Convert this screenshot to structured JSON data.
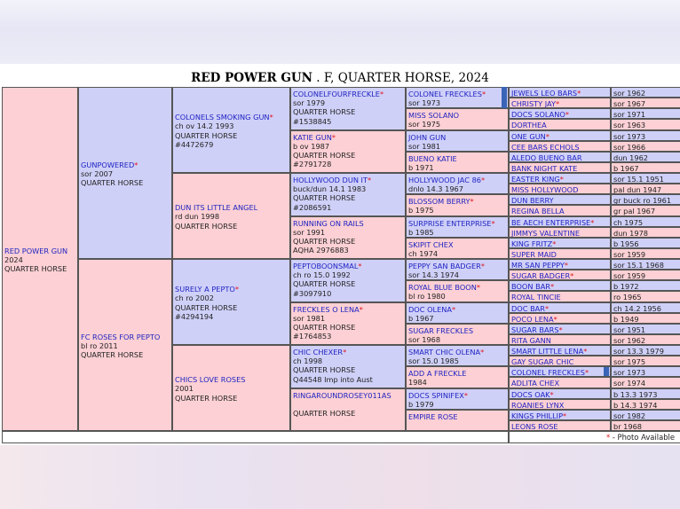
{
  "header": {
    "title_bold": "RED POWER GUN",
    "title_rest": " . F, QUARTER HORSE, 2024"
  },
  "subject": {
    "name": "RED POWER GUN",
    "lines": [
      "2024",
      "QUARTER HORSE"
    ]
  },
  "gen1": [
    {
      "name": "GUNPOWERED",
      "star": true,
      "lines": [
        "sor 2007",
        "QUARTER HORSE"
      ]
    },
    {
      "name": "FC ROSES FOR PEPTO",
      "star": false,
      "lines": [
        "bl ro 2011",
        "QUARTER HORSE"
      ]
    }
  ],
  "gen2": [
    {
      "name": "COLONELS SMOKING GUN",
      "star": true,
      "lines": [
        "ch ov 14.2 1993",
        "QUARTER HORSE",
        "#4472679"
      ]
    },
    {
      "name": "DUN ITS LITTLE ANGEL",
      "star": false,
      "lines": [
        "rd dun 1998",
        "QUARTER HORSE"
      ]
    },
    {
      "name": "SURELY A PEPTO",
      "star": true,
      "lines": [
        "ch ro 2002",
        "QUARTER HORSE",
        "#4294194"
      ]
    },
    {
      "name": "CHICS LOVE ROSES",
      "star": false,
      "lines": [
        "2001",
        "QUARTER HORSE"
      ]
    }
  ],
  "gen3": [
    {
      "name": "COLONELFOURFRECKLE",
      "star": true,
      "lines": [
        "sor 1979",
        "QUARTER HORSE",
        "#1538845"
      ]
    },
    {
      "name": "KATIE GUN",
      "star": true,
      "lines": [
        "b ov 1987",
        "QUARTER HORSE",
        "#2791728"
      ]
    },
    {
      "name": "HOLLYWOOD DUN IT",
      "star": true,
      "lines": [
        "buck/dun 14.1 1983",
        "QUARTER HORSE",
        "#2086591"
      ]
    },
    {
      "name": "RUNNING ON RAILS",
      "star": false,
      "lines": [
        "sor 1991",
        "QUARTER HORSE",
        "AQHA 2976883"
      ]
    },
    {
      "name": "PEPTOBOONSMAL",
      "star": true,
      "lines": [
        "ch ro 15.0 1992",
        "QUARTER HORSE",
        "#3097910"
      ]
    },
    {
      "name": "FRECKLES O LENA",
      "star": true,
      "lines": [
        "sor 1981",
        "QUARTER HORSE",
        "#1764853"
      ]
    },
    {
      "name": "CHIC CHEXER",
      "star": true,
      "lines": [
        "ch 1998",
        "QUARTER HORSE",
        "Q44548 Imp into Aust"
      ]
    },
    {
      "name": "RINGAROUNDROSEY011AS",
      "star": false,
      "lines": [
        "",
        "QUARTER HORSE"
      ]
    }
  ],
  "gen4": [
    {
      "name": "COLONEL FRECKLES",
      "star": true,
      "lines": [
        "sor 1973"
      ]
    },
    {
      "name": "MISS SOLANO",
      "star": false,
      "lines": [
        "sor 1975"
      ]
    },
    {
      "name": "JOHN GUN",
      "star": false,
      "lines": [
        "sor 1981"
      ]
    },
    {
      "name": "BUENO KATIE",
      "star": false,
      "lines": [
        "b 1971"
      ]
    },
    {
      "name": "HOLLYWOOD JAC 86",
      "star": true,
      "lines": [
        "dnlo 14.3 1967"
      ]
    },
    {
      "name": "BLOSSOM BERRY",
      "star": true,
      "lines": [
        "b 1975"
      ]
    },
    {
      "name": "SURPRISE ENTERPRISE",
      "star": true,
      "lines": [
        "b 1985"
      ]
    },
    {
      "name": "SKIPIT CHEX",
      "star": false,
      "lines": [
        "ch 1974"
      ]
    },
    {
      "name": "PEPPY SAN BADGER",
      "star": true,
      "lines": [
        "sor 14.3 1974"
      ]
    },
    {
      "name": "ROYAL BLUE BOON",
      "star": true,
      "lines": [
        "bl ro 1980"
      ]
    },
    {
      "name": "DOC OLENA",
      "star": true,
      "lines": [
        "b 1967"
      ]
    },
    {
      "name": "SUGAR FRECKLES",
      "star": false,
      "lines": [
        "sor 1968"
      ]
    },
    {
      "name": "SMART CHIC OLENA",
      "star": true,
      "lines": [
        "sor 15.0 1985"
      ]
    },
    {
      "name": "ADD A FRECKLE",
      "star": false,
      "lines": [
        "1984"
      ]
    },
    {
      "name": "DOCS SPINIFEX",
      "star": true,
      "lines": [
        "b 1979"
      ]
    },
    {
      "name": "EMPIRE ROSE",
      "star": false,
      "lines": [
        ""
      ]
    }
  ],
  "gen5": [
    {
      "name": "JEWELS LEO BARS",
      "star": true,
      "info": "sor 1962"
    },
    {
      "name": "CHRISTY JAY",
      "star": true,
      "info": "sor 1967"
    },
    {
      "name": "DOCS SOLANO",
      "star": true,
      "info": "sor 1971"
    },
    {
      "name": "DORTHEA",
      "star": false,
      "info": "sor 1963"
    },
    {
      "name": "ONE GUN",
      "star": true,
      "info": "sor 1973"
    },
    {
      "name": "CEE BARS ECHOLS",
      "star": false,
      "info": "sor 1966"
    },
    {
      "name": "ALEDO BUENO BAR",
      "star": false,
      "info": "dun 1962"
    },
    {
      "name": "BANK NIGHT KATE",
      "star": false,
      "info": "b 1967"
    },
    {
      "name": "EASTER KING",
      "star": true,
      "info": "sor 15.1 1951"
    },
    {
      "name": "MISS HOLLYWOOD",
      "star": false,
      "info": "pal dun 1947"
    },
    {
      "name": "DUN BERRY",
      "star": false,
      "info": "gr buck ro 1961"
    },
    {
      "name": "REGINA BELLA",
      "star": false,
      "info": "gr pal 1967"
    },
    {
      "name": "BE AECH ENTERPRISE",
      "star": true,
      "info": "ch 1975"
    },
    {
      "name": "JIMMYS VALENTINE",
      "star": false,
      "info": "dun 1978"
    },
    {
      "name": "KING FRITZ",
      "star": true,
      "info": "b 1956"
    },
    {
      "name": "SUPER MAID",
      "star": false,
      "info": "sor 1959"
    },
    {
      "name": "MR SAN PEPPY",
      "star": true,
      "info": "sor 15.1 1968"
    },
    {
      "name": "SUGAR BADGER",
      "star": true,
      "info": "sor 1959"
    },
    {
      "name": "BOON BAR",
      "star": true,
      "info": "b 1972"
    },
    {
      "name": "ROYAL TINCIE",
      "star": false,
      "info": "ro 1965"
    },
    {
      "name": "DOC BAR",
      "star": true,
      "info": "ch 14.2 1956"
    },
    {
      "name": "POCO LENA",
      "star": true,
      "info": "b 1949"
    },
    {
      "name": "SUGAR BARS",
      "star": true,
      "info": "sor 1951"
    },
    {
      "name": "RITA GANN",
      "star": false,
      "info": "sor 1962"
    },
    {
      "name": "SMART LITTLE LENA",
      "star": true,
      "info": "sor 13.3 1979"
    },
    {
      "name": "GAY SUGAR CHIC",
      "star": false,
      "info": "sor 1975"
    },
    {
      "name": "COLONEL FRECKLES",
      "star": true,
      "info": "sor 1973"
    },
    {
      "name": "ADLITA CHEX",
      "star": false,
      "info": "sor 1974"
    },
    {
      "name": "DOCS OAK",
      "star": true,
      "info": "b 13.3 1973"
    },
    {
      "name": "ROANIES LYNX",
      "star": false,
      "info": "b 14.3 1974"
    },
    {
      "name": "KINGS PHILLIP",
      "star": true,
      "info": "sor 1982"
    },
    {
      "name": "LEONS ROSE",
      "star": false,
      "info": "br 1968"
    }
  ],
  "footer": {
    "star": "*",
    "note": " - Photo Available"
  },
  "colors": {
    "male": "#cfd0f8",
    "female": "#fcd0d4",
    "name": "#1f23c2",
    "star": "#e0141d"
  }
}
